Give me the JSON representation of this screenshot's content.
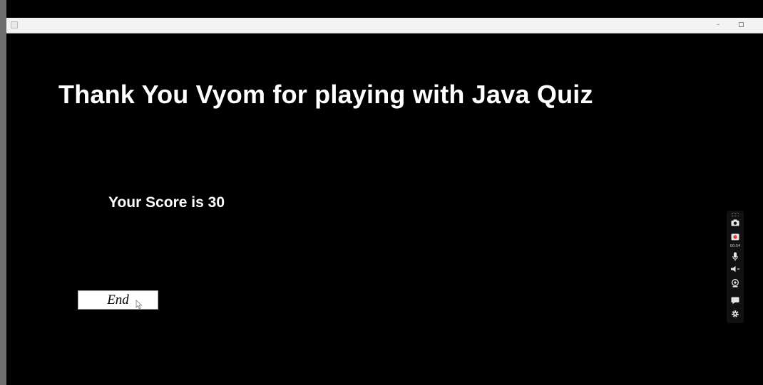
{
  "window": {
    "minimize_glyph": "–",
    "maximize_icon": "maximize-icon"
  },
  "quiz": {
    "heading": "Thank You Vyom for playing with Java Quiz",
    "score_text": "Your Score is 30",
    "end_button_label": "End"
  },
  "recorder_toolbar": {
    "timer": "00:54",
    "icons": [
      "camera-icon",
      "record-icon",
      "microphone-icon",
      "speaker-icon",
      "webcam-icon",
      "chat-icon",
      "gear-icon"
    ]
  },
  "colors": {
    "background": "#000000",
    "text": "#ffffff",
    "titlebar": "#f3f3f3",
    "button_background": "#ffffff",
    "recorder_red": "#e53935"
  }
}
